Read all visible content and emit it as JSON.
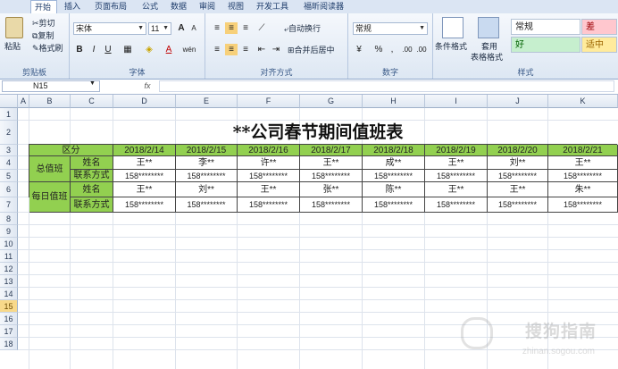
{
  "menu": {
    "tabs": [
      "开始",
      "插入",
      "页面布局",
      "公式",
      "数据",
      "审阅",
      "视图",
      "开发工具",
      "福昕阅读器"
    ],
    "active_index": 0
  },
  "ribbon": {
    "clipboard": {
      "paste": "粘贴",
      "cut": "剪切",
      "copy": "复制",
      "format_painter": "格式刷",
      "label": "剪贴板"
    },
    "font": {
      "name": "宋体",
      "size": "11",
      "bold": "B",
      "italic": "I",
      "underline": "U",
      "grow": "A",
      "shrink": "A",
      "wen": "wén",
      "label": "字体"
    },
    "alignment": {
      "wrap": "自动换行",
      "merge": "合并后居中",
      "label": "对齐方式"
    },
    "number": {
      "format": "常规",
      "percent": "%",
      "comma": ",",
      "inc_dec": ".00",
      "label": "数字"
    },
    "styles": {
      "cond_format": "条件格式",
      "table_format_1": "套用",
      "table_format_2": "表格格式",
      "normal": "常规",
      "bad": "差",
      "good": "好",
      "neutral": "适中",
      "label": "样式"
    }
  },
  "formula_bar": {
    "name_box": "N15",
    "fx": "fx",
    "value": ""
  },
  "columns": [
    "A",
    "B",
    "C",
    "D",
    "E",
    "F",
    "G",
    "H",
    "I",
    "J",
    "K"
  ],
  "rows": [
    "1",
    "2",
    "3",
    "4",
    "5",
    "6",
    "7",
    "8",
    "9",
    "10",
    "11",
    "12",
    "13",
    "14",
    "15",
    "16",
    "17",
    "18"
  ],
  "selected_row": "15",
  "sheet": {
    "title": "**公司春节期间值班表",
    "header_label": "区分",
    "dates": [
      "2018/2/14",
      "2018/2/15",
      "2018/2/16",
      "2018/2/17",
      "2018/2/18",
      "2018/2/19",
      "2018/2/20",
      "2018/2/21"
    ],
    "group1": {
      "label": "总值班",
      "name_label": "姓名",
      "contact_label": "联系方式",
      "names": [
        "王**",
        "李**",
        "许**",
        "王**",
        "成**",
        "王**",
        "刘**",
        "王**"
      ],
      "contacts": [
        "158********",
        "158********",
        "158********",
        "158********",
        "158********",
        "158********",
        "158********",
        "158********"
      ]
    },
    "group2": {
      "label": "每日值班",
      "name_label": "姓名",
      "contact_label": "联系方式",
      "names": [
        "王**",
        "刘**",
        "王**",
        "张**",
        "陈**",
        "王**",
        "王**",
        "朱**"
      ],
      "contacts": [
        "158********",
        "158********",
        "158********",
        "158********",
        "158********",
        "158********",
        "158********",
        "158********"
      ]
    }
  },
  "watermark": {
    "text": "搜狗指南",
    "url": "zhinan.sogou.com"
  },
  "colors": {
    "header_green": "#92d050",
    "selected_row": "#f8d98a",
    "bad_bg": "#ffc7ce",
    "good_bg": "#c6efce",
    "neutral_bg": "#ffeb9c"
  }
}
